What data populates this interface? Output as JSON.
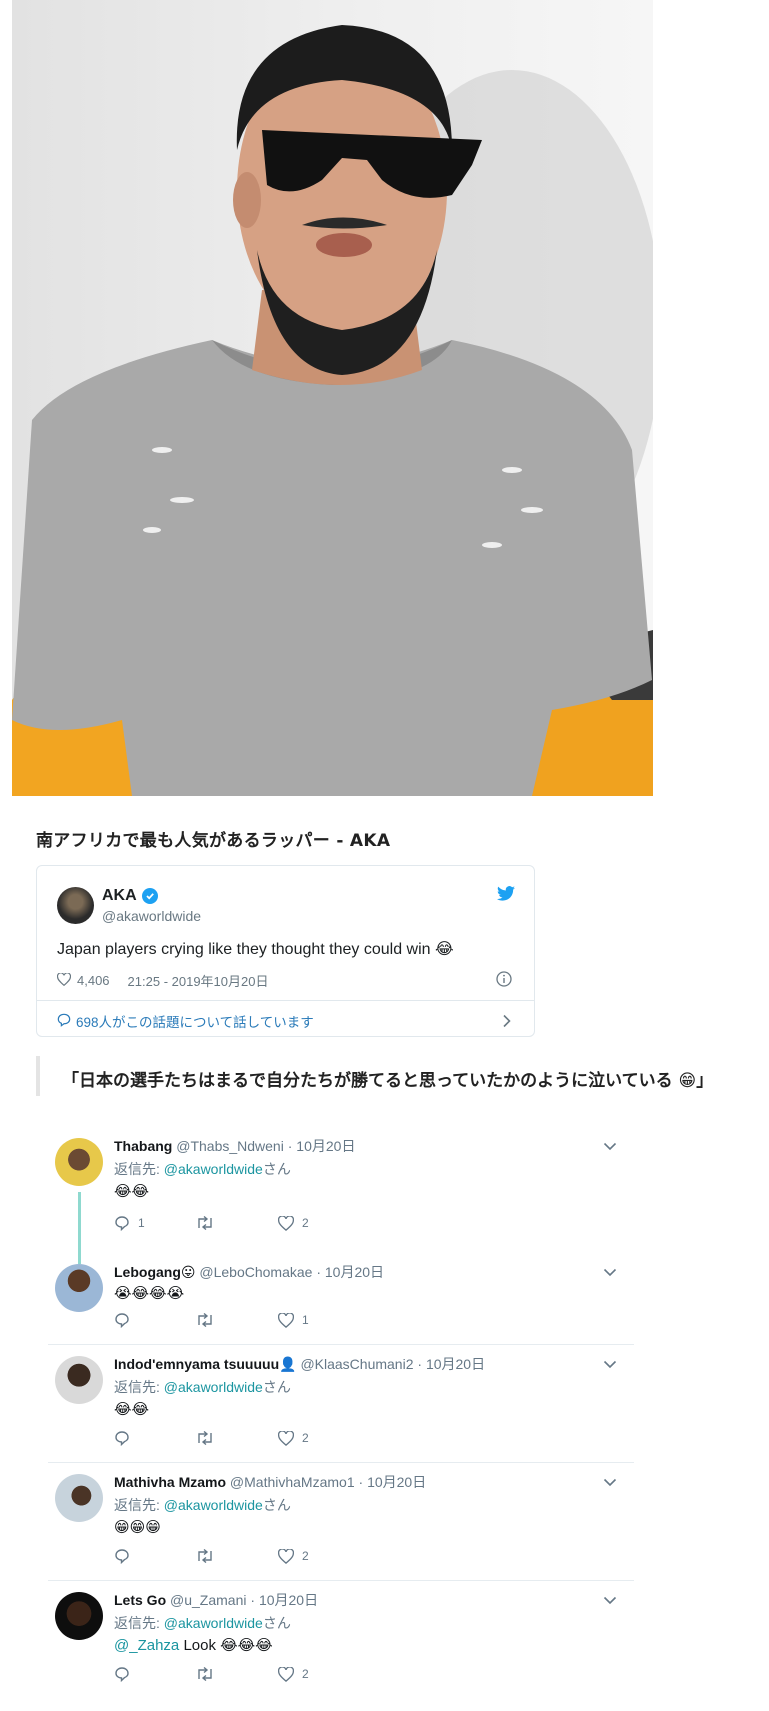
{
  "article": {
    "caption": "南アフリカで最も人気があるラッパー - AKA",
    "quote_text": "「日本の選手たちはまるで自分たちが勝てると思っていたかのように泣いている 😁」"
  },
  "embedded_tweet": {
    "display_name": "AKA",
    "handle": "@akaworldwide",
    "text": "Japan players crying like they thought they could win 😂",
    "likes": "4,406",
    "timestamp": "21:25 - 2019年10月20日",
    "conversation": "698人がこの話題について話しています"
  },
  "replies": [
    {
      "name": "Thabang",
      "handle": "@Thabs_Ndweni",
      "date": "10月20日",
      "reply_prefix": "返信先: ",
      "reply_to": "@akaworldwide",
      "reply_suffix": "さん",
      "body": "😂😂",
      "replies_count": "1",
      "likes": "2"
    },
    {
      "name": "Lebogang😛",
      "handle": "@LeboChomakae",
      "date": "10月20日",
      "body": "😭😂😂😭",
      "replies_count": "",
      "likes": "1"
    },
    {
      "name": "Indod'emnyama tsuuuuu👤",
      "handle": "@KlaasChumani2",
      "date": "10月20日",
      "reply_prefix": "返信先: ",
      "reply_to": "@akaworldwide",
      "reply_suffix": "さん",
      "body": "😂😂",
      "replies_count": "",
      "likes": "2"
    },
    {
      "name": "Mathivha Mzamo",
      "handle": "@MathivhaMzamo1",
      "date": "10月20日",
      "reply_prefix": "返信先: ",
      "reply_to": "@akaworldwide",
      "reply_suffix": "さん",
      "body": "😁😁😁",
      "replies_count": "",
      "likes": "2"
    },
    {
      "name": "Lets Go",
      "handle": "@u_Zamani",
      "date": "10月20日",
      "reply_prefix": "返信先: ",
      "reply_to": "@akaworldwide",
      "reply_suffix": "さん",
      "mention": "@_Zahza",
      "body": "Look 😂😂😂",
      "replies_count": "",
      "likes": "2"
    }
  ],
  "separator": " · ",
  "colors": {
    "twitter_blue": "#1da1f2",
    "link_teal": "#1b95a0",
    "thread_line": "#8fd9cf"
  }
}
